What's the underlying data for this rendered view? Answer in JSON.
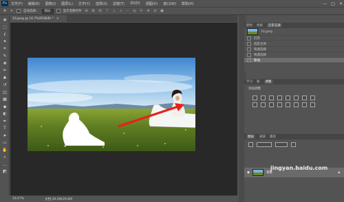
{
  "app": {
    "logo": "Ps"
  },
  "menu": [
    "文件(F)",
    "编辑(E)",
    "图像(I)",
    "图层(L)",
    "文字(Y)",
    "选择(S)",
    "滤镜(T)",
    "3D(D)",
    "视图(V)",
    "窗口(W)",
    "帮助(H)"
  ],
  "window_controls": [
    "—",
    "□",
    "✕"
  ],
  "options": {
    "auto_select_label": "自动选择：",
    "auto_select_value": "图层",
    "show_transform": "显示变换控件"
  },
  "tools": [
    "move-icon",
    "marquee-icon",
    "lasso-icon",
    "magic-wand-icon",
    "crop-icon",
    "eyedropper-icon",
    "healing-icon",
    "brush-icon",
    "stamp-icon",
    "history-brush-icon",
    "eraser-icon",
    "gradient-icon",
    "blur-icon",
    "dodge-icon",
    "pen-icon",
    "type-icon",
    "path-select-icon",
    "shape-icon",
    "hand-icon",
    "zoom-icon",
    "more-icon",
    "colors-icon"
  ],
  "tool_glyphs": [
    "✥",
    "⬚",
    "ℓ",
    "✦",
    "⌗",
    "✎",
    "✚",
    "✏",
    "♣",
    "↺",
    "◫",
    "▦",
    "◆",
    "◐",
    "✒",
    "T",
    "➤",
    "▭",
    "✋",
    "⌕",
    "…",
    "◩"
  ],
  "document": {
    "tab_label": "10.jpeg @ 16.7%(RGB/8) *",
    "close": "×",
    "zoom": "16.67%",
    "doc_info": "文档:29.6M/29.6M"
  },
  "history_panel": {
    "tabs": [
      "颜色",
      "色板",
      "历史记录"
    ],
    "snapshot": "10.jpeg",
    "items": [
      "打开",
      "选区主体",
      "快速选择",
      "快速选择",
      "移动"
    ],
    "selected_index": 4
  },
  "adjust_panel": {
    "tabs": [
      "学习",
      "库",
      "调整"
    ],
    "add_label": "添加调整"
  },
  "layers_panel": {
    "tabs": [
      "图层",
      "通道",
      "路径"
    ],
    "layer_name": "背景"
  },
  "watermark": "jingyan.baidu.com",
  "colors": {
    "arrow": "#e8201a",
    "accent": "#31a8ff"
  }
}
